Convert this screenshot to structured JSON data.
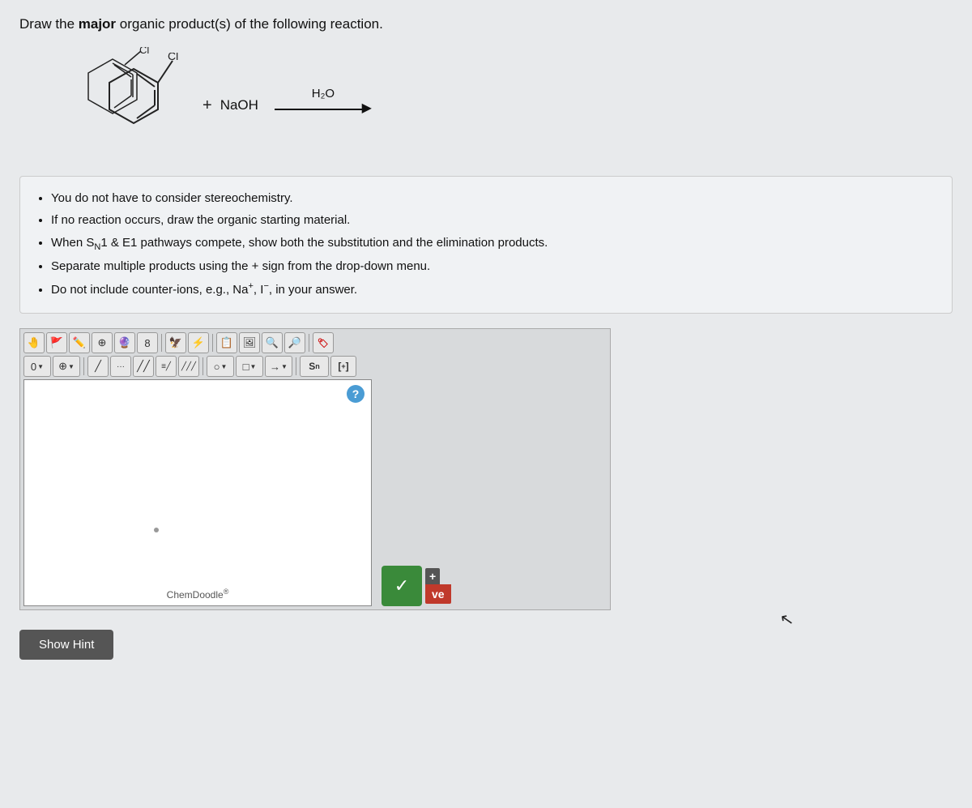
{
  "page": {
    "question": {
      "text_before_bold": "Draw the ",
      "bold": "major",
      "text_after_bold": " organic product(s) of the following reaction."
    },
    "reaction": {
      "plus": "+",
      "reagent": "NaOH",
      "condition": "H₂O",
      "arrow": "→"
    },
    "instructions": [
      "You do not have to consider stereochemistry.",
      "If no reaction occurs, draw the organic starting material.",
      "When S_N1 & E1 pathways compete, show both the substitution and the elimination products.",
      "Separate multiple products using the + sign from the drop-down menu.",
      "Do not include counter-ions, e.g., Na⁺, I⁻, in your answer."
    ],
    "toolbar": {
      "row1_icons": [
        "hand-icon",
        "eraser-icon",
        "ring-icon",
        "template-icon",
        "bracket-icon",
        "lasso-icon",
        "charge-icon",
        "copy-icon",
        "zoom-in-icon",
        "zoom-out-icon",
        "atom-icon"
      ],
      "row2_icons": [
        "zero-dropdown",
        "plus-circle-dropdown",
        "bond-single",
        "bond-dotted",
        "bond-double",
        "bond-triple",
        "bond-multi",
        "shape-circle",
        "shape-square",
        "shape-hex-dropdown",
        "sn-label",
        "bracket-label"
      ]
    },
    "canvas": {
      "question_mark": "?",
      "watermark": "ChemDoodle",
      "reg_symbol": "®"
    },
    "buttons": {
      "check_label": "✓",
      "plus_label": "+",
      "ve_label": "ve",
      "show_hint": "Show Hint"
    }
  }
}
